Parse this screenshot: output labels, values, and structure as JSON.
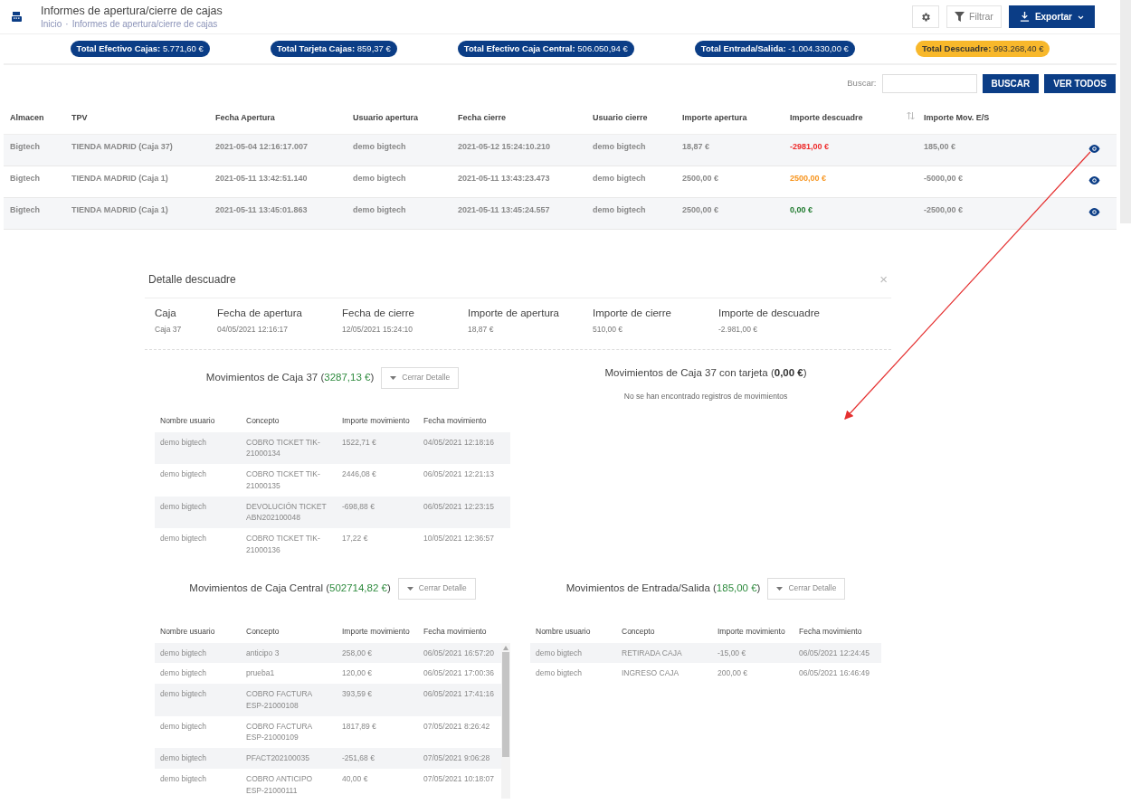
{
  "header": {
    "title": "Informes de apertura/cierre de cajas",
    "breadcrumb": [
      "Inicio",
      "Informes de apertura/cierre de cajas"
    ],
    "breadcrumb_separator": "·",
    "filter_button": "Filtrar",
    "export_button": "Exportar"
  },
  "totals": [
    {
      "label": "Total Efectivo Cajas:",
      "value": "5.771,60 €",
      "kind": "dark"
    },
    {
      "label": "Total Tarjeta Cajas:",
      "value": "859,37 €",
      "kind": "dark"
    },
    {
      "label": "Total Efectivo Caja Central:",
      "value": "506.050,94 €",
      "kind": "dark"
    },
    {
      "label": "Total Entrada/Salida:",
      "value": "-1.004.330,00 €",
      "kind": "dark"
    },
    {
      "label": "Total Descuadre:",
      "value": "993.268,40 €",
      "kind": "highlight"
    }
  ],
  "search": {
    "label": "Buscar:",
    "buttons": [
      "BUSCAR",
      "VER TODOS"
    ]
  },
  "table": {
    "columns": [
      {
        "label": "Almacen",
        "sortable": false
      },
      {
        "label": "TPV",
        "sortable": false
      },
      {
        "label": "Fecha Apertura",
        "sortable": false
      },
      {
        "label": "Usuario apertura",
        "sortable": false
      },
      {
        "label": "Fecha cierre",
        "sortable": false
      },
      {
        "label": "Usuario cierre",
        "sortable": false
      },
      {
        "label": "Importe apertura",
        "sortable": false
      },
      {
        "label": "Importe descuadre",
        "sortable": true
      },
      {
        "label": "Importe Mov. E/S",
        "sortable": false
      }
    ],
    "rows": [
      {
        "cells": [
          "Bigtech",
          "TIENDA MADRID (Caja 37)",
          "2021-05-04 12:16:17.007",
          "demo bigtech",
          "2021-05-12 15:24:10.210",
          "demo bigtech",
          "18,87 €",
          "-2981,00 €",
          "185,00 €"
        ],
        "color": "#ee2a2a"
      },
      {
        "cells": [
          "Bigtech",
          "TIENDA MADRID (Caja 1)",
          "2021-05-11 13:42:51.140",
          "demo bigtech",
          "2021-05-11 13:43:23.473",
          "demo bigtech",
          "2500,00 €",
          "2500,00 €",
          "-5000,00 €"
        ],
        "color": "#f7941d"
      },
      {
        "cells": [
          "Bigtech",
          "TIENDA MADRID (Caja 1)",
          "2021-05-11 13:45:01.863",
          "demo bigtech",
          "2021-05-11 13:45:24.557",
          "demo bigtech",
          "2500,00 €",
          "0,00 €",
          "-2500,00 €"
        ],
        "color": "#1f7a2e"
      }
    ]
  },
  "detail": {
    "title": "Detalle descuadre",
    "close": "×",
    "summary": [
      {
        "label": "Caja",
        "value": "Caja 37"
      },
      {
        "label": "Fecha de apertura",
        "value": "04/05/2021 12:16:17"
      },
      {
        "label": "Fecha de cierre",
        "value": "12/05/2021 15:24:10"
      },
      {
        "label": "Importe de apertura",
        "value": "18,87 €"
      },
      {
        "label": "Importe de cierre",
        "value": "510,00 €"
      },
      {
        "label": "Importe de descuadre",
        "value": "-2.981,00 €"
      }
    ],
    "sections": [
      {
        "title": "Movimientos de Caja 37",
        "amount": "(3287,13 €)",
        "color": "#2e8b3e",
        "button": "Cerrar Detalle",
        "scrollable": false,
        "columns": [
          "Nombre usuario",
          "Concepto",
          "Importe movimiento",
          "Fecha movimiento"
        ],
        "rows": [
          [
            "demo bigtech",
            "COBRO TICKET TIK-21000134",
            "1522,71 €",
            "04/05/2021 12:18:16"
          ],
          [
            "demo bigtech",
            "COBRO TICKET TIK-21000135",
            "2446,08 €",
            "06/05/2021 12:21:13"
          ],
          [
            "demo bigtech",
            "DEVOLUCIÓN TICKET ABN202100048",
            "-698,88 €",
            "06/05/2021 12:23:15"
          ],
          [
            "demo bigtech",
            "COBRO TICKET TIK-21000136",
            "17,22 €",
            "10/05/2021 12:36:57"
          ]
        ]
      },
      {
        "title": "Movimientos de Caja 37 con tarjeta",
        "amount": "(0,00 €)",
        "color": "#333333",
        "empty_message": "No se han encontrado registros de movimientos"
      },
      {
        "title": "Movimientos de Caja Central",
        "amount": "(502714,82 €)",
        "color": "#2e8b3e",
        "button": "Cerrar Detalle",
        "scrollable": true,
        "columns": [
          "Nombre usuario",
          "Concepto",
          "Importe movimiento",
          "Fecha movimiento"
        ],
        "rows": [
          [
            "demo bigtech",
            "anticipo 3",
            "258,00 €",
            "06/05/2021 16:57:20"
          ],
          [
            "demo bigtech",
            "prueba1",
            "120,00 €",
            "06/05/2021 17:00:36"
          ],
          [
            "demo bigtech",
            "COBRO FACTURA ESP-21000108",
            "393,59 €",
            "06/05/2021 17:41:16"
          ],
          [
            "demo bigtech",
            "COBRO FACTURA ESP-21000109",
            "1817,89 €",
            "07/05/2021 8:26:42"
          ],
          [
            "demo bigtech",
            "PFACT202100035",
            "-251,68 €",
            "07/05/2021 9:06:28"
          ],
          [
            "demo bigtech",
            "COBRO ANTICIPO ESP-21000111",
            "40,00 €",
            "07/05/2021 10:18:07"
          ]
        ]
      },
      {
        "title": "Movimientos de Entrada/Salida",
        "amount": "(185,00 €)",
        "color": "#2e8b3e",
        "button": "Cerrar Detalle",
        "scrollable": false,
        "columns": [
          "Nombre usuario",
          "Concepto",
          "Importe movimiento",
          "Fecha movimiento"
        ],
        "rows": [
          [
            "demo bigtech",
            "RETIRADA CAJA",
            "-15,00 €",
            "06/05/2021 12:24:45"
          ],
          [
            "demo bigtech",
            "INGRESO CAJA",
            "200,00 €",
            "06/05/2021 16:46:49"
          ]
        ]
      }
    ]
  }
}
